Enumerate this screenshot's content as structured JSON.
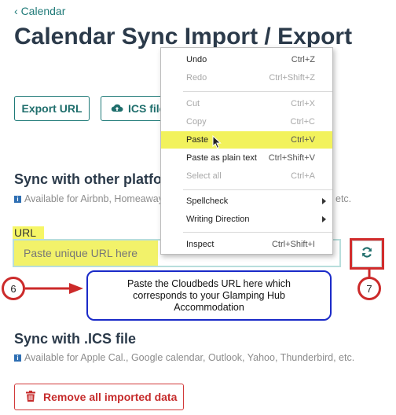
{
  "nav": {
    "back_label": "Calendar",
    "back_chevron": "‹"
  },
  "page": {
    "title": "Calendar Sync Import / Export"
  },
  "toolbar": {
    "export_url_label": "Export URL",
    "ics_label": "ICS file",
    "ics_icon": "cloud-upload-icon"
  },
  "sync_other": {
    "title": "Sync with other platforms",
    "note_left": "Available for Airbnb, Homeaway",
    "note_right": "etc."
  },
  "url_field": {
    "label": "URL",
    "placeholder": "Paste unique URL here"
  },
  "sync_button": {
    "icon": "refresh-icon"
  },
  "annotations": {
    "step_left": "6",
    "step_right": "7",
    "callout_text": "Paste the Cloudbeds URL here which corresponds to your Glamping Hub Accommodation",
    "highlight_color": "#f2f26a",
    "marker_color": "#cc2a2a",
    "callout_border_color": "#1a2ac8"
  },
  "sync_ics": {
    "title": "Sync with .ICS file",
    "note": "Available for Apple Cal., Google calendar, Outlook, Yahoo, Thunderbird, etc."
  },
  "remove": {
    "label": "Remove all imported data",
    "icon": "trash-icon"
  },
  "context_menu": {
    "undo": {
      "label": "Undo",
      "shortcut": "Ctrl+Z"
    },
    "redo": {
      "label": "Redo",
      "shortcut": "Ctrl+Shift+Z"
    },
    "cut": {
      "label": "Cut",
      "shortcut": "Ctrl+X"
    },
    "copy": {
      "label": "Copy",
      "shortcut": "Ctrl+C"
    },
    "paste": {
      "label": "Paste",
      "shortcut": "Ctrl+V"
    },
    "paste_plain": {
      "label": "Paste as plain text",
      "shortcut": "Ctrl+Shift+V"
    },
    "select_all": {
      "label": "Select all",
      "shortcut": "Ctrl+A"
    },
    "spellcheck": {
      "label": "Spellcheck"
    },
    "writing_direction": {
      "label": "Writing Direction"
    },
    "inspect": {
      "label": "Inspect",
      "shortcut": "Ctrl+Shift+I"
    }
  },
  "colors": {
    "accent": "#1f7a78",
    "title": "#2b3a4a",
    "danger": "#c62c2c"
  }
}
